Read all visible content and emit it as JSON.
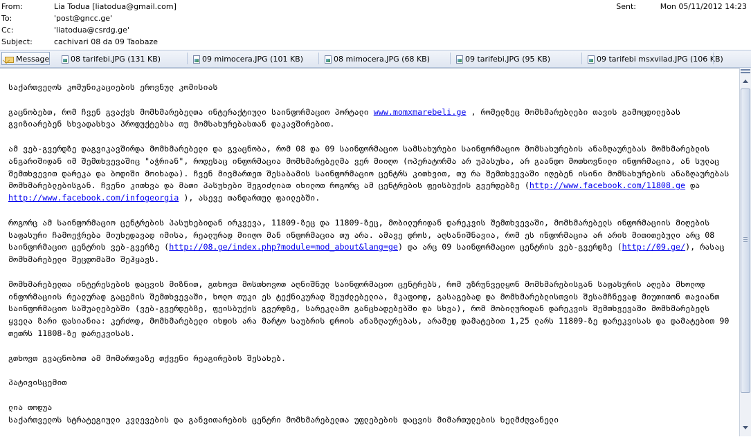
{
  "header": {
    "from_label": "From:",
    "from_value": "Lia Todua [liatodua@gmail.com]",
    "to_label": "To:",
    "to_value": "'post@gncc.ge'",
    "cc_label": "Cc:",
    "cc_value": "'liatodua@csrdg.ge'",
    "subject_label": "Subject:",
    "subject_value": "cachivari 08 da 09 Taobaze",
    "sent_label": "Sent:",
    "sent_value": "Mon 05/11/2012 14:23"
  },
  "attachments": {
    "message_tab": "Message",
    "items": [
      "08 tarifebi.JPG (131 KB)",
      "09 mimocera.JPG (101 KB)",
      "08 mimocera.JPG (68 KB)",
      "09 tarifebi.JPG (95 KB)",
      "09 tarifebi msxvilad.JPG (106 KB)"
    ]
  },
  "body": {
    "greeting": "საქართველოს კომუნიკაციების ეროვნულ კომისიას",
    "p1_pre": "გაცნობებთ, რომ ჩვენ გვაქვს მომხმარებელთა ინტერაქტიული საინფორმაციო პორტალი ",
    "p1_link": "www.momxmarebeli.ge",
    "p1_post": " , რომელზეც მომხმარებლები თავის გამოცდილებას გვიზიარებენ სხვადასხვა პროდუქტებსა თუ მომსახურებასთან დაკავშირებით.",
    "p2_pre": "ამ ვებ-გვერდზე დაგვიკავშირდა მომხმარებელი და გვაცნობა, რომ 08 და 09 საინფორმაციო სამსახურები საინფორმაციო მომსახურების ანაზღაურებას მომხმარებლის ანგარიშიდან იმ შემთხვევაშიც \"აჭრიან\", როდესაც ინფორმაცია მომხმარებელმა ვერ მიიღო (ოპერატორმა არ უპასუხა, არ გაანდო მოთხოვნილი ინფორმაცია, ან სულაც შემთხვევით დარეკა და ბოდიში მოიხადა). ჩვენ მივმართეთ შესაბამის საინფორმაციო ცენტრს კითხვით, თუ რა შემთხვევაში იღებენ ისინი მომსახურების ანაზღაურებას მომხმარებლებისგან. ჩვენი კითხვა და მათი პასუხები შეგიძლიათ იხილოთ როგორც ამ ცენტრების ფეისბუქის გვერდებზე (",
    "p2_link1": "http://www.facebook.com/11808.ge",
    "p2_mid": " და ",
    "p2_link2": "http://www.facebook.com/infogeorgia",
    "p2_post": " ), ასევე თანდართულ ფაილებში.",
    "p3_pre": "როგორც ამ საინფორმაციო ცენტრების პასუხებიდან ირკვევა, 11809-ზეც და 11809-ზეც, მობილურიდან დარეკვის შემთხვევაში, მომხმარებელს ინფორმაციის მიღების საფასური ჩამოეჭრება მიუხედავად იმისა, რეალურად მიიღო მან ინფორმაცია თუ არა. ამავე დროს, აღსანიშნავია, რომ ეს ინფორმაცია არ არის მითითებული არც 08 საინფორმაციო ცენტრის ვებ-გვერზე (",
    "p3_link1": "http://08.ge/index.php?module=mod_about&lang=ge",
    "p3_mid": ") და არც 09 საინფორმაციო ცენტრის ვებ-გვერდზე (",
    "p3_link2": "http://09.ge/",
    "p3_post": "), რასაც მომხმარებელი შეცდომაში შეჰყავს.",
    "p4": "მომხმარებელთა ინტერესების დაცვის მიზნით, გთხოვთ მოსთხოვოთ აღნიშნულ საინფორმაციო ცენტრებს, რომ უზრუნველყონ მომხმარებისგან საფასურის აღება მხოლოდ ინფორმაციის რეალურად გაცემის შემთხვევაში, ხოლო თუკი ეს ტექნიკურად შეუძლებელია, მკაფიოდ, გასაგებად და მომხმარებლისთვის შესამჩნევად მიუთითონ თავიანთ საინფორმაციო საშუალებებში (ვებ-გვერდებზე, ფეისბუქის გვერდზე, სარეკლამო განცხადებებში და სხვა), რომ მობილურიდან დარეკვის შემთხვევაში მომხმარებელს ყველა ზარი ფასიანია: კერძოდ, მომხმარებელი იხდის არა მარტო საუბრის დროის ანაზღაურებას, არამედ დამატებით 1,25 ლარს 11809-ზე დარეკვისას და დამატებით 90 თეთრს 11808-ზე დარეკვისას.",
    "p5": "გთხოვთ გვაცნობოთ ამ მომართვაზე თქვენი რეაგირების შესახებ.",
    "closing": "პატივისცემით",
    "sig_name": "ლია თოდუა",
    "sig_title": "საქართველოს სტრატეგიული კვლევების და განვითარების ცენტრი მომხმარებელთა უფლებების დაცვის მიმართულების ხელმძღვანელი"
  },
  "colors": {
    "link": "#0000ee",
    "attachment_bar": "#dfe6f1"
  }
}
